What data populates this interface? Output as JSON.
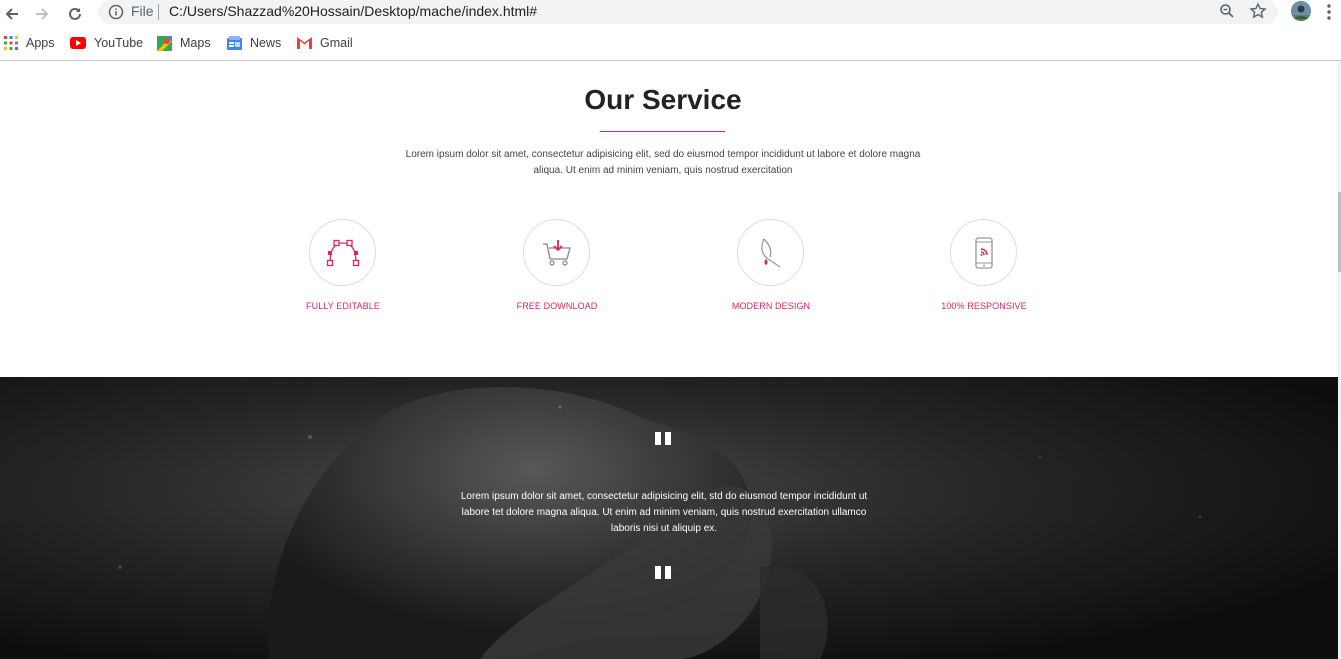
{
  "browser": {
    "scheme": "File",
    "url": "C:/Users/Shazzad%20Hossain/Desktop/mache/index.html#"
  },
  "bookmarks": [
    {
      "label": "Apps"
    },
    {
      "label": "YouTube"
    },
    {
      "label": "Maps"
    },
    {
      "label": "News"
    },
    {
      "label": "Gmail"
    }
  ],
  "service": {
    "title": "Our Service",
    "description": "Lorem ipsum dolor sit amet, consectetur adipisicing elit, sed do eiusmod tempor incididunt ut labore et dolore magna aliqua. Ut enim ad minim veniam, quis nostrud exercitation",
    "features": [
      {
        "label": "FULLY EDITABLE",
        "icon": "bezier-curve-icon"
      },
      {
        "label": "FREE DOWNLOAD",
        "icon": "cart-download-icon"
      },
      {
        "label": "MODERN DESIGN",
        "icon": "pen-nib-icon"
      },
      {
        "label": "100% RESPONSIVE",
        "icon": "mobile-icon"
      }
    ],
    "accent_color": "#e0245e"
  },
  "testimonial": {
    "text": "Lorem ipsum dolor sit amet, consectetur adipisicing elit, std do eiusmod tempor incididunt ut labore tet dolore magna aliqua. Ut enim ad minim veniam, quis nostrud exercitation ullamco laboris nisi ut aliquip ex."
  }
}
